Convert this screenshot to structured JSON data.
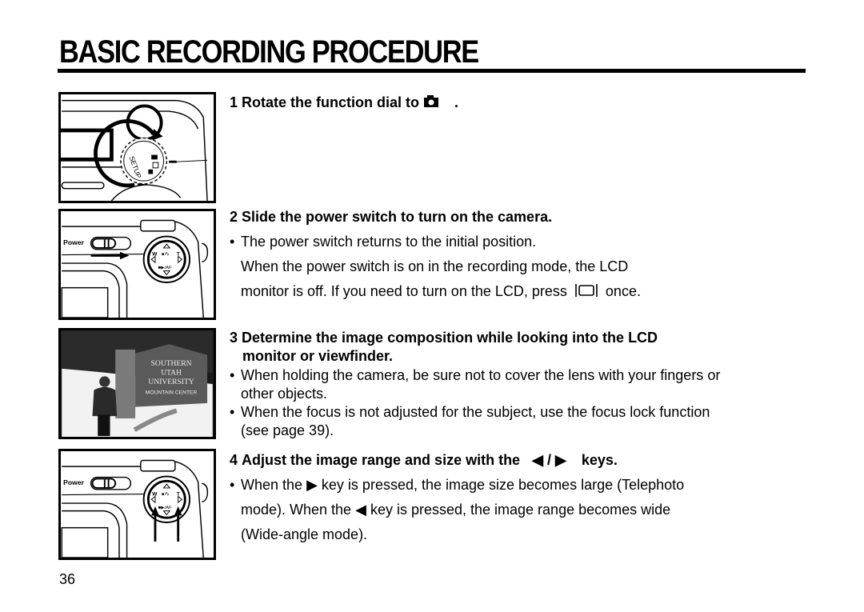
{
  "page": {
    "title": "BASIC RECORDING PROCEDURE",
    "page_number": "36"
  },
  "figures": {
    "dial": {
      "label": "Function dial illustration",
      "dial_text": "SETUP"
    },
    "power": {
      "label": "Power switch illustration",
      "switch_label": "Power",
      "pad_labels": {
        "w": "W",
        "t": "T",
        "top": "●/ϟ",
        "bottom": "■▶/AF"
      }
    },
    "photo": {
      "label": "Photo of person at sign",
      "sign_lines": [
        "SOUTHERN",
        "UTAH",
        "UNIVERSITY",
        "MOUNTAIN CENTER"
      ]
    },
    "keys": {
      "label": "Zoom keys illustration",
      "switch_label": "Power",
      "pad_labels": {
        "w": "W",
        "t": "T",
        "top": "●/ϟ",
        "bottom": "■▶/AF"
      }
    }
  },
  "steps": [
    {
      "number": "1",
      "heading_before_icon": "Rotate the function dial to",
      "icon": "camera-icon",
      "heading_after_icon": "."
    },
    {
      "number": "2",
      "heading": "Slide the power switch to turn on the camera.",
      "bullet": "•",
      "lines": [
        "The power switch returns to the initial position.",
        "When the power switch is on in the recording mode, the LCD",
        "monitor is off. If you need to turn on the LCD, press"
      ],
      "lcd_icon": "lcd-button-icon",
      "line3_end": "once."
    },
    {
      "number": "3",
      "heading_line1": "Determine the image composition while looking into the LCD",
      "heading_line2": "monitor or viewfinder.",
      "bullet": "•",
      "bullets": [
        {
          "line1": "When holding the camera, be sure not to cover the lens with your fingers or",
          "line2": "other objects."
        },
        {
          "line1": "When the focus is not adjusted for the subject, use the focus lock function",
          "line2": "(see page 39)."
        }
      ]
    },
    {
      "number": "4",
      "heading_before": "Adjust the image range and size with the",
      "left_icon": "◀",
      "separator": "/",
      "right_icon": "▶",
      "heading_after": "keys.",
      "bullet": "•",
      "line1_before": "When the",
      "line1_icon": "▶",
      "line1_after": "key is pressed, the image size becomes large (Telephoto",
      "line2_before": "mode). When the",
      "line2_icon": "◀",
      "line2_after": "key is pressed, the image range becomes wide",
      "line3": "(Wide-angle mode)."
    }
  ]
}
